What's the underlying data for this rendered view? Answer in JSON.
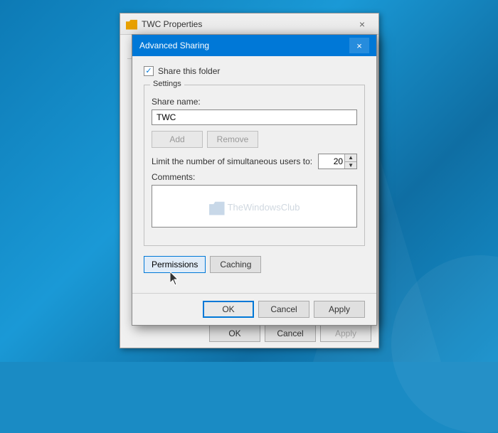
{
  "desktop": {
    "background": "#1a8bc4"
  },
  "bg_window": {
    "title": "TWC Properties",
    "close_btn": "×",
    "bottom_buttons": {
      "ok": "OK",
      "cancel": "Cancel",
      "apply": "Apply"
    }
  },
  "dialog": {
    "title": "Advanced Sharing",
    "close_btn": "×",
    "share_checkbox": {
      "checked": true,
      "label": "Share this folder"
    },
    "settings_group_label": "Settings",
    "share_name_label": "Share name:",
    "share_name_value": "TWC",
    "add_button": "Add",
    "remove_button": "Remove",
    "limit_label": "Limit the number of simultaneous users to:",
    "limit_value": "20",
    "comments_label": "Comments:",
    "comments_value": "",
    "watermark_text": "TheWindowsClub",
    "permissions_button": "Permissions",
    "caching_button": "Caching",
    "bottom": {
      "ok": "OK",
      "cancel": "Cancel",
      "apply": "Apply"
    }
  }
}
